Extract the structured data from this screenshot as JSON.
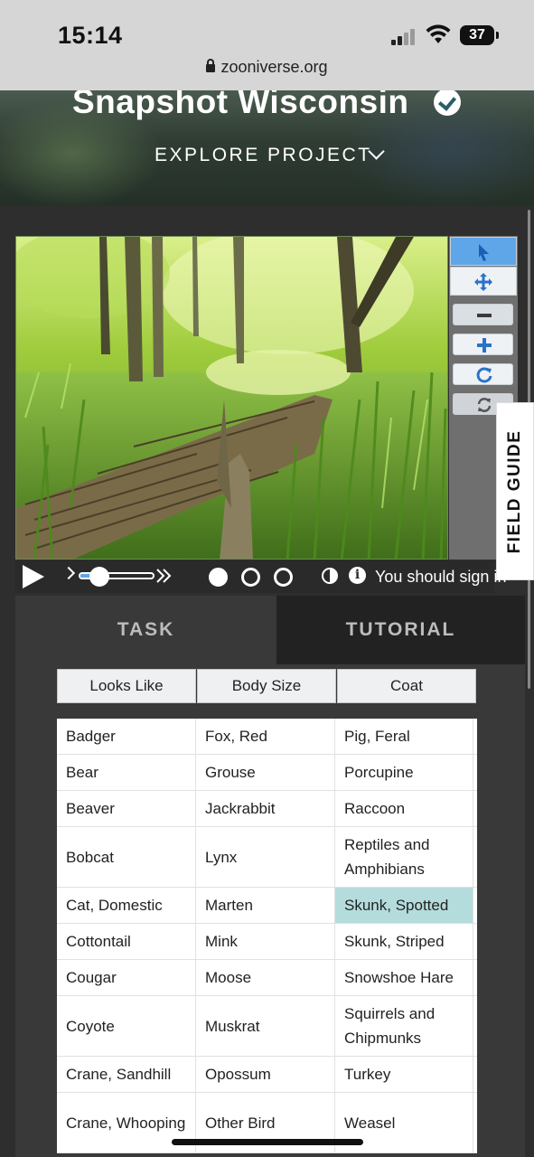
{
  "status_bar": {
    "time": "15:14",
    "battery": "37",
    "url": "zooniverse.org"
  },
  "header": {
    "title": "Snapshot Wisconsin",
    "explore_label": "EXPLORE PROJECT"
  },
  "viewer": {
    "tools": [
      "pointer-icon",
      "move-icon",
      "zoom-out-icon",
      "zoom-in-icon",
      "rotate-icon",
      "reset-icon"
    ],
    "field_guide_label": "FIELD GUIDE",
    "playback_progress": 0.2,
    "frames_total": 3,
    "frame_current": 1,
    "sign_in_text": "You should sign in"
  },
  "tabs": [
    {
      "label": "TASK",
      "active": true
    },
    {
      "label": "TUTORIAL",
      "active": false
    }
  ],
  "filters": [
    "Looks Like",
    "Body Size",
    "Coat"
  ],
  "species_rows": [
    [
      "Badger",
      "Fox, Red",
      "Pig, Feral"
    ],
    [
      "Bear",
      "Grouse",
      "Porcupine"
    ],
    [
      "Beaver",
      "Jackrabbit",
      "Raccoon"
    ],
    [
      "Bobcat",
      "Lynx",
      "Reptiles and Amphibians"
    ],
    [
      "Cat, Domestic",
      "Marten",
      "Skunk, Spotted"
    ],
    [
      "Cottontail",
      "Mink",
      "Skunk, Striped"
    ],
    [
      "Cougar",
      "Moose",
      "Snowshoe Hare"
    ],
    [
      "Coyote",
      "Muskrat",
      "Squirrels and Chipmunks"
    ],
    [
      "Crane, Sandhill",
      "Opossum",
      "Turkey"
    ],
    [
      "Crane, Whooping",
      "Other Bird",
      "Weasel"
    ]
  ],
  "selected_species": "Skunk, Spotted",
  "colors": {
    "accent": "#5fa6e8",
    "selected": "#b4dcdd",
    "panel": "#393939"
  }
}
